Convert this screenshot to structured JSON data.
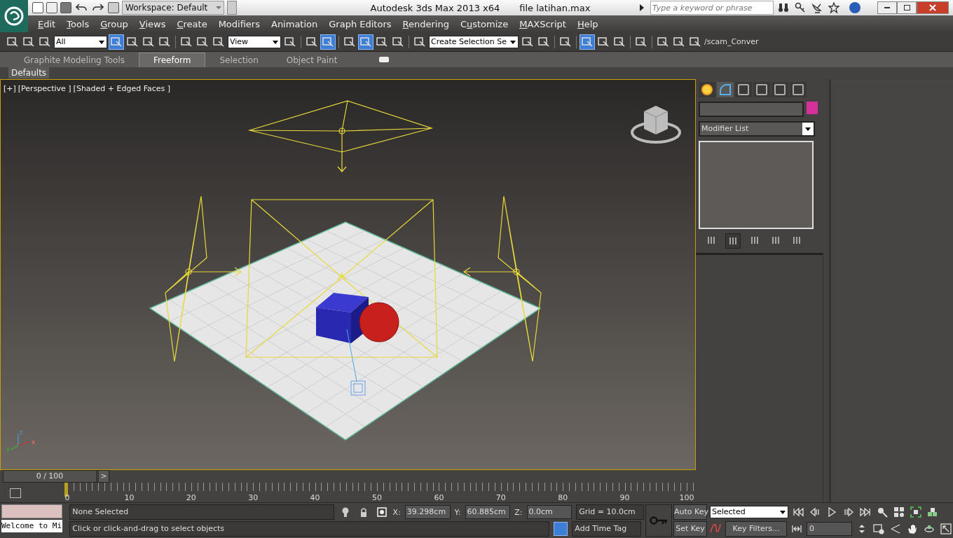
{
  "title_bar": {
    "workspace": "Workspace: Default",
    "app_title": "Autodesk 3ds Max  2013 x64",
    "file_name": "file latihan.max",
    "search": {
      "placeholder": "Type a keyword or phrase"
    }
  },
  "menu": [
    "Edit",
    "Tools",
    "Group",
    "Views",
    "Create",
    "Modifiers",
    "Animation",
    "Graph Editors",
    "Rendering",
    "Customize",
    "MAXScript",
    "Help"
  ],
  "main_toolbar": [
    {
      "kind": "icon",
      "active": false
    },
    {
      "kind": "icon",
      "active": false
    },
    {
      "kind": "icon",
      "active": false
    },
    {
      "kind": "dropdown",
      "value": "All"
    },
    {
      "kind": "icon",
      "active": true
    },
    {
      "kind": "icon",
      "active": false
    },
    {
      "kind": "icon",
      "active": false
    },
    {
      "kind": "icon",
      "active": false
    },
    {
      "kind": "separator"
    },
    {
      "kind": "icon",
      "active": false
    },
    {
      "kind": "icon",
      "active": false
    },
    {
      "kind": "icon",
      "active": false
    },
    {
      "kind": "dropdown",
      "value": "View"
    },
    {
      "kind": "icon",
      "active": false
    },
    {
      "kind": "separator"
    },
    {
      "kind": "icon",
      "active": false
    },
    {
      "kind": "icon",
      "active": true
    },
    {
      "kind": "separator"
    },
    {
      "kind": "icon",
      "active": false
    },
    {
      "kind": "icon",
      "active": true
    },
    {
      "kind": "icon",
      "active": false
    },
    {
      "kind": "icon",
      "active": false
    },
    {
      "kind": "separator"
    },
    {
      "kind": "icon",
      "active": false
    },
    {
      "kind": "dropdown",
      "value": "Create Selection Se"
    },
    {
      "kind": "icon",
      "active": false
    },
    {
      "kind": "icon",
      "active": false
    },
    {
      "kind": "separator"
    },
    {
      "kind": "icon",
      "active": false
    },
    {
      "kind": "separator"
    },
    {
      "kind": "icon",
      "active": true
    },
    {
      "kind": "icon",
      "active": false
    },
    {
      "kind": "icon",
      "active": false
    },
    {
      "kind": "separator"
    },
    {
      "kind": "icon",
      "active": false
    },
    {
      "kind": "separator"
    },
    {
      "kind": "icon",
      "active": false
    },
    {
      "kind": "icon",
      "active": false
    },
    {
      "kind": "icon",
      "active": false
    },
    {
      "kind": "text",
      "value": "/scam_Conver"
    }
  ],
  "ribbon_tabs": [
    {
      "label": "Graphite Modeling Tools",
      "selected": false
    },
    {
      "label": "Freeform",
      "selected": true
    },
    {
      "label": "Selection",
      "selected": false
    },
    {
      "label": "Object Paint",
      "selected": false
    }
  ],
  "ribbon_panel": "Defaults",
  "viewport": {
    "labels": [
      "[+]",
      "[Perspective ]",
      "[Shaded + Edged Faces ]"
    ],
    "axis_labels": [
      "z",
      "y",
      "x"
    ]
  },
  "command_panel": {
    "tabs": [
      {
        "selected": false
      },
      {
        "selected": true
      },
      {
        "selected": false
      },
      {
        "selected": false
      },
      {
        "selected": false
      },
      {
        "selected": false
      }
    ],
    "modifier_list": "Modifier List",
    "stack_buttons": [
      {
        "active": false
      },
      {
        "active": true
      },
      {
        "active": false
      },
      {
        "active": false
      },
      {
        "active": false
      }
    ]
  },
  "time_slider": {
    "label": "0 / 100",
    "level": 0,
    "next": ">"
  },
  "track_bar": {
    "ticks": [
      "0",
      "10",
      "20",
      "30",
      "40",
      "50",
      "60",
      "70",
      "80",
      "90",
      "100"
    ]
  },
  "status": {
    "listener": "Welcome to Mi",
    "selection": "None Selected",
    "prompt": "Click or click-and-drag to select objects",
    "x_label": "X:",
    "x": "39.298cm",
    "y_label": "Y:",
    "y": "60.885cm",
    "z_label": "Z:",
    "z": "0.0cm",
    "grid": "Grid = 10.0cm",
    "time_tag": "Add Time Tag"
  },
  "animation": {
    "auto_key": "Auto Key",
    "set_key": "Set Key",
    "key_mode": "Selected",
    "key_filters": "Key Filters...",
    "frame": "0"
  }
}
